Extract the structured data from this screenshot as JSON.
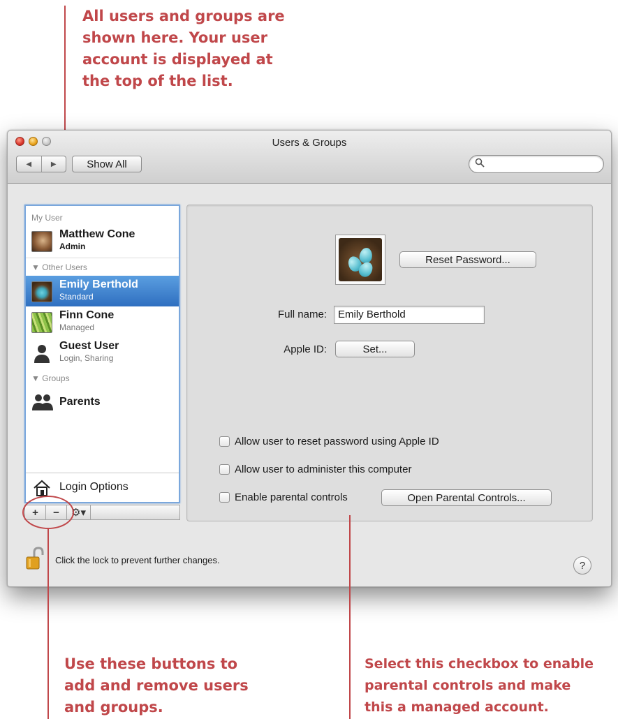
{
  "callouts": {
    "top": [
      "All users and groups are",
      "shown here. Your user",
      "account is displayed at",
      "the top of the list."
    ],
    "bottom_left": [
      "Use these buttons to",
      "add and remove users",
      "and groups."
    ],
    "bottom_right": [
      "Select this checkbox to enable",
      "parental controls and make",
      "this a managed account."
    ],
    "color": "#c0474a"
  },
  "window": {
    "title": "Users & Groups",
    "show_all": "Show All",
    "nav_back": "◀",
    "nav_forward": "▶",
    "search_icon": "magnifier-icon",
    "search_symbol": "⚲"
  },
  "sidebar": {
    "my_user_header": "My User",
    "other_users_header": "▼ Other Users",
    "groups_header": "▼ Groups",
    "users": [
      {
        "name": "Matthew Cone",
        "role": "Admin"
      },
      {
        "name": "Emily Berthold",
        "role": "Standard"
      },
      {
        "name": "Finn Cone",
        "role": "Managed"
      },
      {
        "name": "Guest User",
        "role": "Login, Sharing"
      }
    ],
    "groups": [
      {
        "name": "Parents"
      }
    ],
    "login_options": "Login Options",
    "selection_color": "#3a7fd0"
  },
  "toolbar": {
    "plus": "+",
    "minus": "−",
    "gear": "⚙▾"
  },
  "details": {
    "reset_password": "Reset Password...",
    "full_name_label": "Full name:",
    "full_name_value": "Emily Berthold",
    "apple_id_label": "Apple ID:",
    "apple_id_button": "Set...",
    "allow_reset": "Allow user to reset password using Apple ID",
    "allow_admin": "Allow user to administer this computer",
    "enable_parental": "Enable parental controls",
    "open_parental": "Open Parental Controls..."
  },
  "footer": {
    "lock_text": "Click the lock to prevent further changes.",
    "help": "?"
  }
}
